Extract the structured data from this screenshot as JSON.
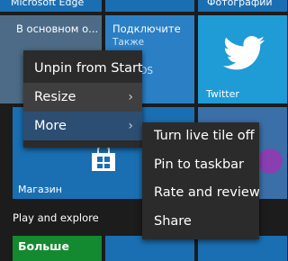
{
  "tiles": {
    "edge": {
      "label": "Microsoft Edge",
      "color": "#1a6fb3"
    },
    "photos": {
      "label": "Фотографии",
      "color": "#1a6fb3"
    },
    "weather": {
      "label": "В основном о...",
      "color": "#4d6b86"
    },
    "connect": {
      "lines": [
        "Подключите",
        "Также",
        "и iOS"
      ],
      "color": "#2b7fc4"
    },
    "twitter": {
      "label": "Twitter",
      "color": "#1f9bd6",
      "icon": "twitter-bird-icon"
    },
    "store": {
      "label": "Магазин",
      "color": "#1a6fb3",
      "icon": "store-bag-icon"
    },
    "candy": {
      "color": "#3b6fa8",
      "icon": "candy-crush-icon"
    },
    "green": {
      "label": "Больше",
      "color": "#138a2f"
    },
    "blue_bottom": {
      "color": "#1a6fb3"
    }
  },
  "section": {
    "title": "Play and explore"
  },
  "context_menu": {
    "items": [
      {
        "label": "Unpin from Start",
        "has_submenu": false
      },
      {
        "label": "Resize",
        "has_submenu": true,
        "chevron": "›"
      },
      {
        "label": "More",
        "has_submenu": true,
        "chevron": "›"
      }
    ]
  },
  "submenu": {
    "items": [
      {
        "label": "Turn live tile off"
      },
      {
        "label": "Pin to taskbar"
      },
      {
        "label": "Rate and review"
      },
      {
        "label": "Share"
      }
    ]
  },
  "colors": {
    "menu_bg": "#2b2b2b",
    "selected": "#2d4e73",
    "hover": "#3f3f3f",
    "accent_blue": "#1a6fb3"
  }
}
